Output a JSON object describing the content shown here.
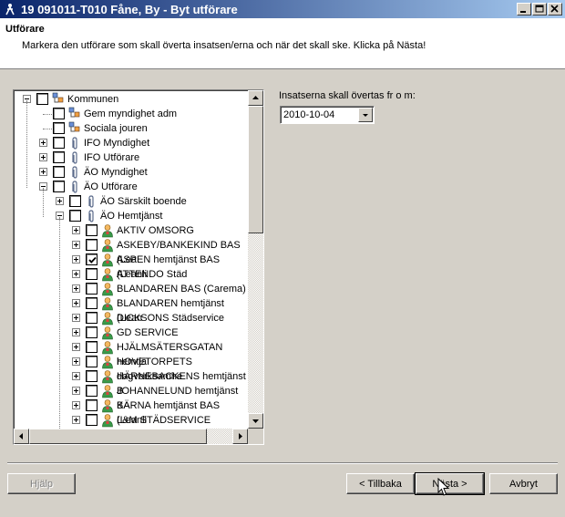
{
  "window": {
    "title": "19 091011-T010 Fåne, By - Byt utförare"
  },
  "header": {
    "title": "Utförare",
    "description": "Markera den utförare som skall överta insatsen/erna och när det skall ske. Klicka på Nästa!"
  },
  "tree": {
    "root": {
      "label": "Kommunen",
      "checked": false
    },
    "nodes": [
      {
        "label": "Gem myndighet adm",
        "checked": false,
        "icon": "group-icon",
        "expander": "none"
      },
      {
        "label": "Sociala jouren",
        "checked": false,
        "icon": "group-icon",
        "expander": "none"
      },
      {
        "label": "IFO Myndighet",
        "checked": false,
        "icon": "paperclip-icon",
        "expander": "plus"
      },
      {
        "label": "IFO Utförare",
        "checked": false,
        "icon": "paperclip-icon",
        "expander": "plus"
      },
      {
        "label": "ÄO Myndighet",
        "checked": false,
        "icon": "paperclip-icon",
        "expander": "plus"
      },
      {
        "label": "ÄO Utförare",
        "checked": false,
        "icon": "paperclip-icon",
        "expander": "minus"
      },
      {
        "label": "ÄO Särskilt boende",
        "checked": false,
        "icon": "paperclip-icon",
        "expander": "plus"
      },
      {
        "label": "ÄO Hemtjänst",
        "checked": false,
        "icon": "paperclip-icon",
        "expander": "minus"
      },
      {
        "label": "AKTIV OMSORG",
        "checked": false,
        "icon": "person-icon",
        "expander": "plus"
      },
      {
        "label": "ASKEBY/BANKEKIND BAS (Lea",
        "checked": false,
        "icon": "person-icon",
        "expander": "plus"
      },
      {
        "label": "ASPEN hemtjänst BAS (Leanli",
        "checked": true,
        "icon": "person-icon",
        "expander": "plus"
      },
      {
        "label": "ATTENDO Städ",
        "checked": false,
        "icon": "person-icon",
        "expander": "plus"
      },
      {
        "label": "BLANDAREN BAS  (Carema)",
        "checked": false,
        "icon": "person-icon",
        "expander": "plus"
      },
      {
        "label": "BLANDAREN hemtjänst (Lean",
        "checked": false,
        "icon": "person-icon",
        "expander": "plus"
      },
      {
        "label": "DICKSONS Städservice",
        "checked": false,
        "icon": "person-icon",
        "expander": "plus"
      },
      {
        "label": "GD SERVICE",
        "checked": false,
        "icon": "person-icon",
        "expander": "plus"
      },
      {
        "label": "HJÄLMSÄTERSGATAN hemtjä",
        "checked": false,
        "icon": "person-icon",
        "expander": "plus"
      },
      {
        "label": "HOVETORPETS dagverksamhe",
        "checked": false,
        "icon": "person-icon",
        "expander": "plus"
      },
      {
        "label": "HÄRNEBACKENS hemtjänst B",
        "checked": false,
        "icon": "person-icon",
        "expander": "plus"
      },
      {
        "label": "JOHANNELUND hemtjänst BA",
        "checked": false,
        "icon": "person-icon",
        "expander": "plus"
      },
      {
        "label": "KÄRNA hemtjänst BAS (Leanli",
        "checked": false,
        "icon": "person-icon",
        "expander": "plus"
      },
      {
        "label": "L&M STÄDSERVICE",
        "checked": false,
        "icon": "person-icon",
        "expander": "plus"
      }
    ]
  },
  "date": {
    "label": "Insatserna skall övertas fr o m:",
    "value": "2010-10-04"
  },
  "buttons": {
    "help": "Hjälp",
    "back": "< Tillbaka",
    "next": "Nästa >",
    "cancel": "Avbryt"
  },
  "colors": {
    "titlebar_start": "#0a246a",
    "titlebar_end": "#a6caf0",
    "face": "#d4d0c8"
  }
}
